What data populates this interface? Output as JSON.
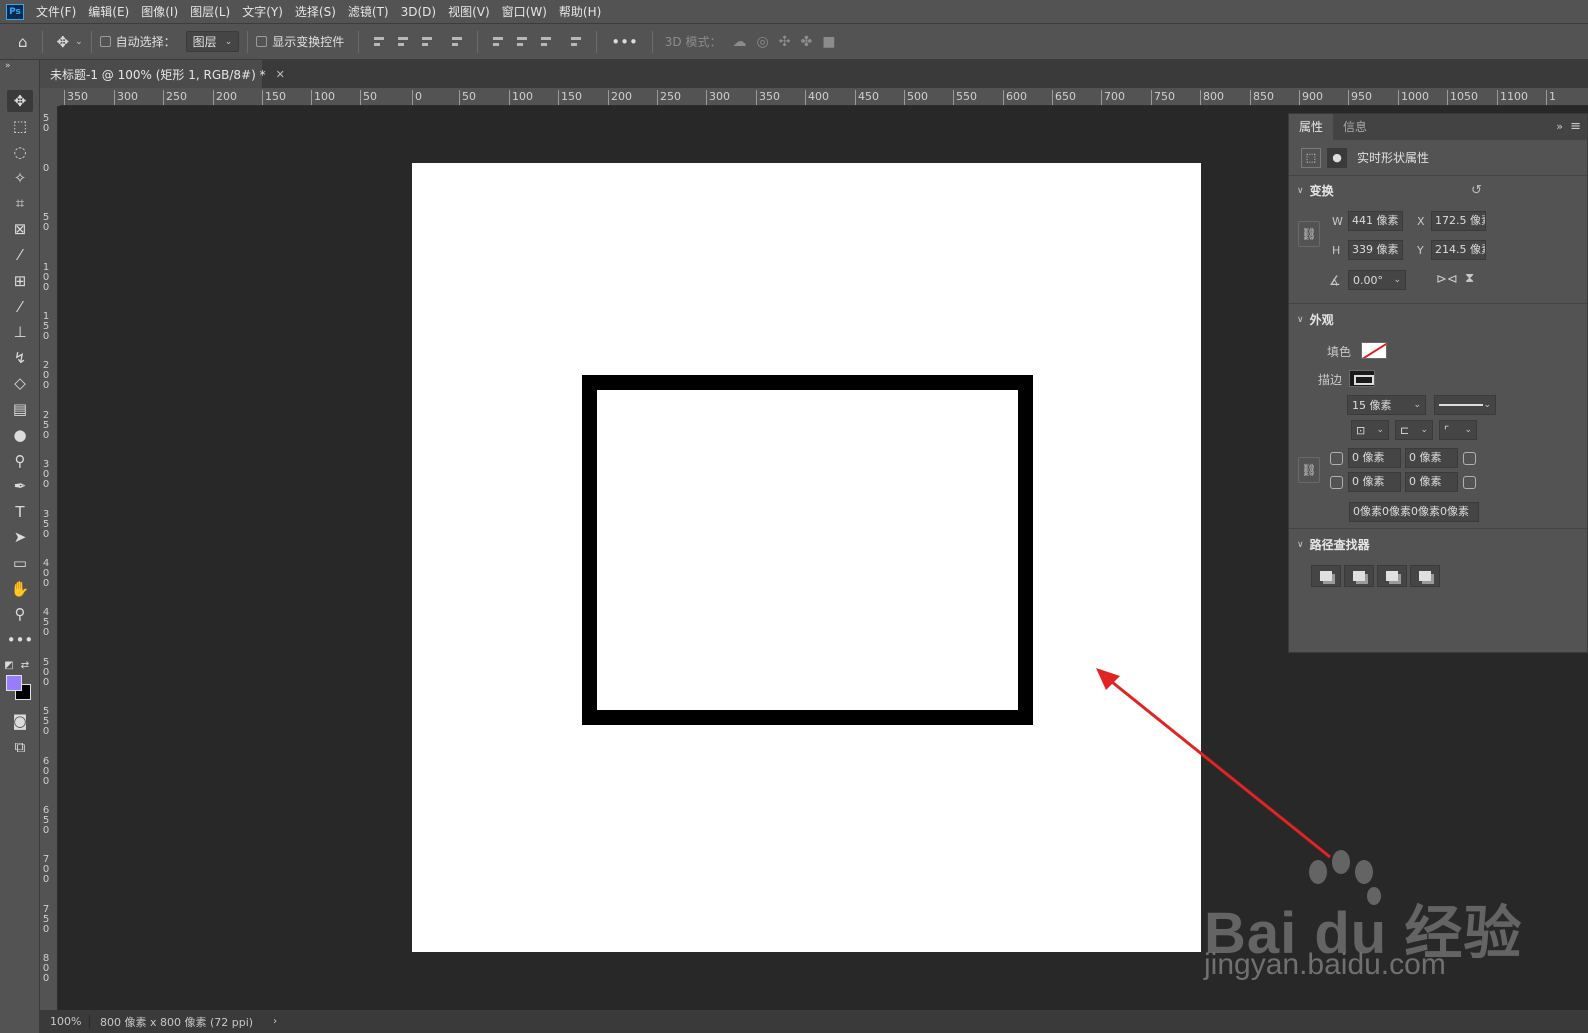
{
  "menubar": {
    "logo": "Ps",
    "items": [
      "文件(F)",
      "编辑(E)",
      "图像(I)",
      "图层(L)",
      "文字(Y)",
      "选择(S)",
      "滤镜(T)",
      "3D(D)",
      "视图(V)",
      "窗口(W)",
      "帮助(H)"
    ]
  },
  "options": {
    "auto_select_label": "自动选择：",
    "auto_select_value": "图层",
    "show_transform_label": "显示变换控件",
    "mode_3d_label": "3D 模式："
  },
  "document": {
    "tab_title": "未标题-1 @ 100% (矩形 1, RGB/8#) *"
  },
  "rulers": {
    "horizontal": [
      "350",
      "300",
      "250",
      "200",
      "150",
      "100",
      "50",
      "0",
      "50",
      "100",
      "150",
      "200",
      "250",
      "300",
      "350",
      "400",
      "450",
      "500",
      "550",
      "600",
      "650",
      "700",
      "750",
      "800",
      "850",
      "900",
      "950",
      "1000",
      "1050",
      "1100",
      "1"
    ],
    "vertical": [
      "50",
      "0",
      "50",
      "100",
      "150",
      "200",
      "250",
      "300",
      "350",
      "400",
      "450",
      "500",
      "550",
      "600",
      "650",
      "700",
      "750",
      "800"
    ]
  },
  "panel": {
    "tabs": [
      "属性",
      "信息"
    ],
    "header_label": "实时形状属性",
    "transform": {
      "title": "变换",
      "w_label": "W",
      "w_value": "441 像素",
      "x_label": "X",
      "x_value": "172.5 像素",
      "h_label": "H",
      "h_value": "339 像素",
      "y_label": "Y",
      "y_value": "214.5 像素",
      "angle_value": "0.00°"
    },
    "appearance": {
      "title": "外观",
      "fill_label": "填色",
      "stroke_label": "描边",
      "stroke_width": "15 像素",
      "corner_tl": "0 像素",
      "corner_tr": "0 像素",
      "corner_bl": "0 像素",
      "corner_br": "0 像素",
      "corners_summary": "0像素0像素0像素0像素"
    },
    "pathfinder": {
      "title": "路径查找器"
    }
  },
  "statusbar": {
    "zoom": "100%",
    "doc_info": "800 像素 x 800 像素 (72 ppi)"
  },
  "watermark": {
    "logo_text": "Bai du 经验",
    "url": "jingyan.baidu.com"
  },
  "colors": {
    "foreground": "#9a7cff",
    "background": "#000000",
    "annotation_arrow": "#e02424"
  }
}
